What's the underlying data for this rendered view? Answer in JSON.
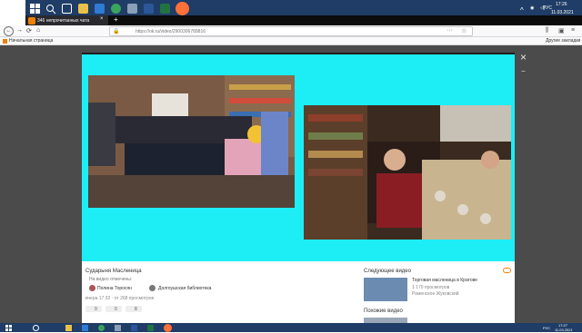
{
  "taskbar_top": {
    "tray_lang": "РУС",
    "tray_time": "17:26",
    "tray_date": "11.03.2021"
  },
  "browser": {
    "tab_title": "346 непрочитанных чата",
    "url": "https://ok.ru/video/2900306789816",
    "bookmark_label": "Начальная страница",
    "bookmark_right": "Другие закладки"
  },
  "video": {
    "title": "Сударыня Масленица",
    "marked_label": "На видео отмечены:",
    "person_tag": "Полина Торосян",
    "group_tag": "Долгоушская библиотека",
    "meta": "вчера 17:32 · от 268 просмотров",
    "likes_count": "0",
    "shares_count": "0",
    "class_count": "8"
  },
  "sidebar": {
    "next_label": "Следующее видео",
    "next_title": "Торговая масленица в Кратове",
    "next_views": "1 170 просмотров",
    "next_channel": "Раменское Жуковский",
    "similar_label": "Похожие видео"
  },
  "taskbar_bottom": {
    "tray_lang": "РУС",
    "tray_time": "17:27",
    "tray_date": "11.03.2021"
  },
  "colors": {
    "cyan_background": "#1dedf5",
    "ok_orange": "#ee8208",
    "taskbar": "#1f3d66"
  }
}
